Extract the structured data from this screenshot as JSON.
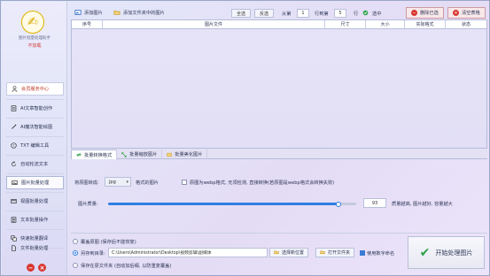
{
  "sidebar": {
    "app_name": "图片批量处理助手",
    "reg_status": "不加载",
    "items": [
      {
        "label": "会员服务中心",
        "icon": "user-icon"
      },
      {
        "label": "AI文章智能创作",
        "icon": "ai-doc-icon"
      },
      {
        "label": "AI魔法智能绘图",
        "icon": "ai-draw-icon"
      },
      {
        "label": "TXT 编辑工具",
        "icon": "txt-icon"
      },
      {
        "label": "自动轮流文本",
        "icon": "rotate-icon"
      },
      {
        "label": "图片批量处理",
        "icon": "image-icon"
      },
      {
        "label": "视图批量处理",
        "icon": "view-icon"
      },
      {
        "label": "文本批量操作",
        "icon": "text-icon"
      },
      {
        "label": "快速批量翻译",
        "icon": "translate-icon"
      },
      {
        "label": "文件批量处理",
        "icon": "file-icon"
      }
    ]
  },
  "toolbar": {
    "add_images": "添加图片",
    "add_folder": "添加文件夹中的图片",
    "select_all": "全选",
    "invert": "反选",
    "from_label": "从第",
    "from_value": "1",
    "row_count_label": "行到第",
    "row_count_value": "5",
    "row_label": "行",
    "check_label": "选中",
    "remove_done": "删除已选",
    "clear_list": "清空表格"
  },
  "table": {
    "columns": [
      "序号",
      "图片文件",
      "尺寸",
      "大小",
      "实际格式",
      "状态"
    ]
  },
  "tabs": [
    {
      "label": "批量转换格式",
      "icon": "convert-icon"
    },
    {
      "label": "批量缩放图片",
      "icon": "resize-icon"
    },
    {
      "label": "批量美化图片",
      "icon": "beautify-icon"
    }
  ],
  "options": {
    "convert_label": "将原图转成:",
    "format_value": "jpg",
    "format_suffix": "格式的图片",
    "webp_check": "原图为webp格式, 无须检测, 直接转换(若原图是webp格式会转换失败)",
    "quality_label": "图片质量:",
    "quality_value": "93",
    "quality_fraction": 0.93,
    "quality_hint": "质量越高, 图片越好, 容量越大"
  },
  "output": {
    "overwrite": "覆盖原图 (保存后不能恢复)",
    "save_to": "另存到目录:",
    "save_path": "C:\\Users\\Administrator\\Desktop\\视频剪辑\\副媒体",
    "choose_btn": "选择新位置",
    "open_btn": "打开文件夹",
    "use_number": "使用数字命名",
    "save_original_folder": "保存在原文件夹 (自动加后缀, 以防重复覆盖)"
  },
  "start_button": "开始处理图片",
  "colors": {
    "accent_blue": "#2f7fe0",
    "danger_red": "#d8352f",
    "success_green": "#2ea14a"
  }
}
